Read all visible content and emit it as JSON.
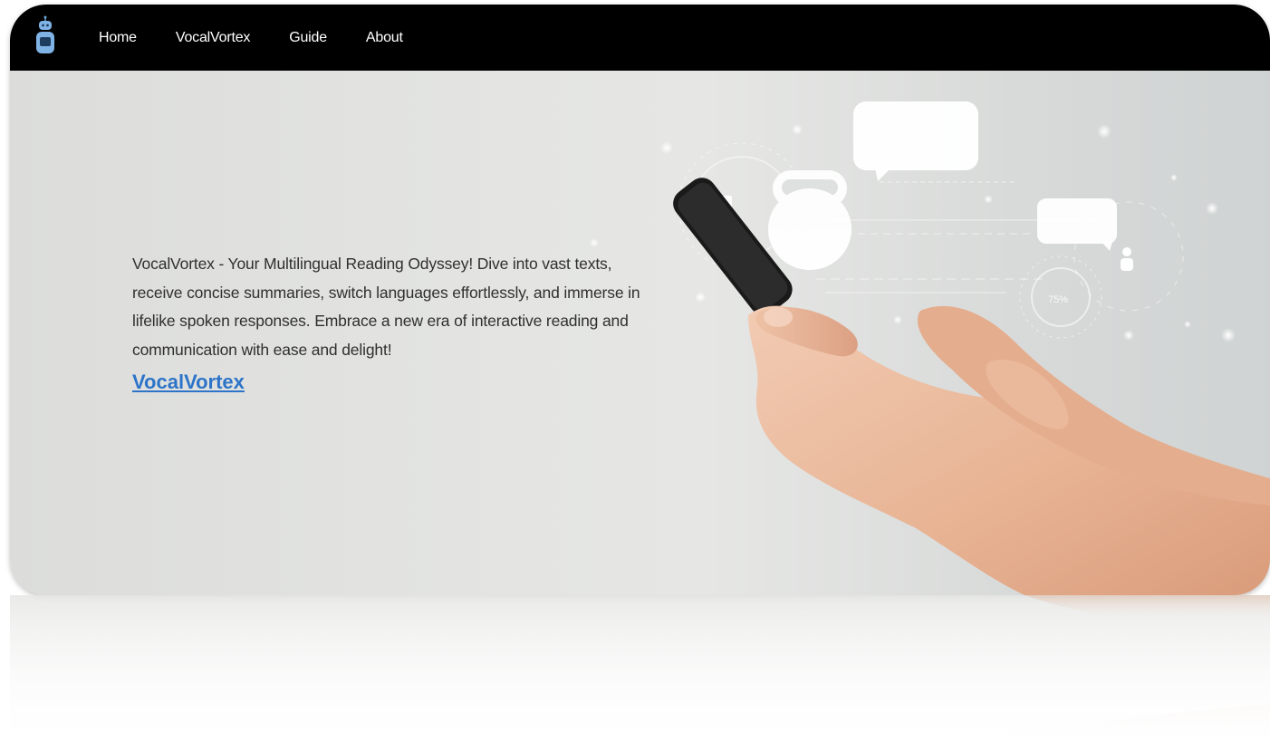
{
  "navbar": {
    "logo_icon": "robot-icon",
    "links": [
      {
        "label": "Home"
      },
      {
        "label": "VocalVortex"
      },
      {
        "label": "Guide"
      },
      {
        "label": "About"
      }
    ]
  },
  "hero": {
    "description": "VocalVortex - Your Multilingual Reading Odyssey! Dive into vast texts, receive concise summaries, switch languages effortlessly, and immerse in lifelike spoken responses. Embrace a new era of interactive reading and communication with ease and delight!",
    "cta_label": "VocalVortex",
    "illustration": {
      "icons": [
        "chat-bubble-icon",
        "robot-head-icon",
        "user-icon",
        "hand-holding-phone"
      ],
      "progress_label": "75%"
    }
  },
  "colors": {
    "navbar_bg": "#000000",
    "nav_text": "#ffffff",
    "body_text": "#2f2f2f",
    "link": "#2d74c8",
    "hero_bg": "#e3e4e2"
  }
}
